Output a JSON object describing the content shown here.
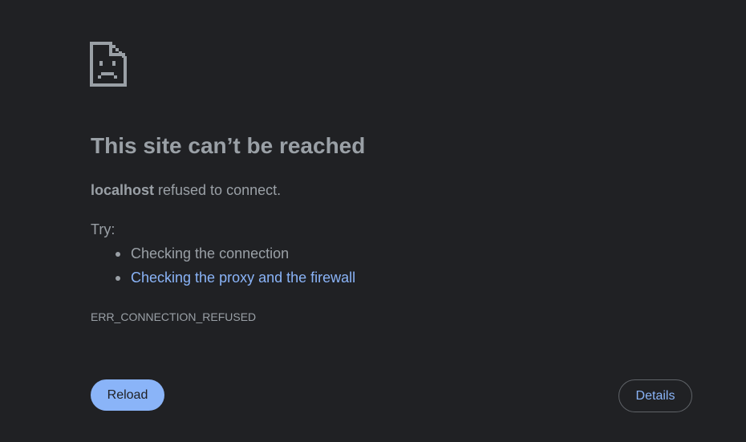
{
  "error": {
    "icon": "sad-file-icon",
    "title": "This site can’t be reached",
    "host": "localhost",
    "summary_suffix": " refused to connect.",
    "try_label": "Try:",
    "suggestions": [
      {
        "label": "Checking the connection",
        "is_link": false
      },
      {
        "label": "Checking the proxy and the firewall",
        "is_link": true
      }
    ],
    "code": "ERR_CONNECTION_REFUSED"
  },
  "buttons": {
    "reload_label": "Reload",
    "details_label": "Details"
  },
  "colors": {
    "background": "#202124",
    "text": "#9aa0a6",
    "link": "#8ab4f8",
    "primary_button": "#8ab4f8",
    "outline": "#5f6368"
  }
}
